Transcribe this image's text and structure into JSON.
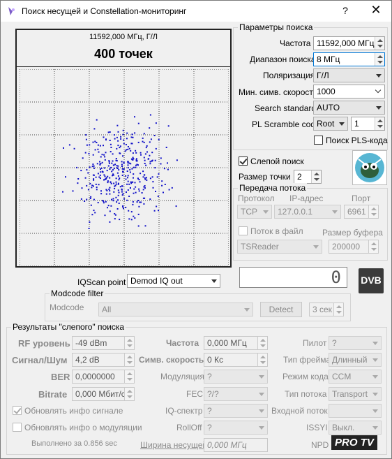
{
  "window": {
    "title": "Поиск несущей и Constellation-мониторинг",
    "help": "?",
    "close": "✕"
  },
  "constellation": {
    "freq_label": "11592,000 МГц, Г/Л",
    "points_label": "400 точек"
  },
  "search_params": {
    "group_title": "Параметры поиска",
    "freq_label": "Частота",
    "freq_value": "11592,000 МГц",
    "range_label": "Диапазон поиска",
    "range_value": "8 МГц",
    "pol_label": "Поляризация",
    "pol_value": "Г/Л",
    "symrate_label": "Мин. симв. скорость",
    "symrate_value": "1000",
    "standard_label": "Search standard",
    "standard_value": "AUTO",
    "pls_label": "PL Scramble code",
    "pls_mode": "Root",
    "pls_value": "1",
    "pls_search_label": "Поиск PLS-кода"
  },
  "blind": {
    "label": "Слепой поиск",
    "dot_size_label": "Размер точки",
    "dot_size_value": "2"
  },
  "stream": {
    "group_title": "Передача потока",
    "protocol_label": "Протокол",
    "ip_label": "IP-адрес",
    "port_label": "Порт",
    "protocol_value": "TCP",
    "ip_value": "127.0.0.1",
    "port_value": "6961",
    "to_file_label": "Поток в файл",
    "buffer_label": "Размер буфера",
    "app_value": "TSReader",
    "buffer_value": "200000"
  },
  "iqscan": {
    "label": "IQScan point",
    "value": "Demod IQ out",
    "counter": "0",
    "logo": "DVB"
  },
  "modcode": {
    "group_title": "Modcode filter",
    "label": "Modcode",
    "value": "All",
    "detect": "Detect",
    "timeout": "3 сек"
  },
  "results": {
    "group_title": "Результаты \"слепого\" поиска",
    "rf_label": "RF уровень",
    "rf_value": "-49 dBm",
    "snr_label": "Сигнал/Шум",
    "snr_value": "4,2 dB",
    "ber_label": "BER",
    "ber_value": "0,0000000",
    "bitrate_label": "Bitrate",
    "bitrate_value": "0,000 Мбит/с",
    "freq_label": "Частота",
    "freq_value": "0,000 МГц",
    "sym_label": "Симв. скорость",
    "sym_value": "0 Кс",
    "mod_label": "Модуляция",
    "mod_value": "?",
    "fec_label": "FEC",
    "fec_value": "?/?",
    "iq_label": "IQ-спектр",
    "iq_value": "?",
    "rolloff_label": "RollOff",
    "rolloff_value": "?",
    "pilot_label": "Пилот",
    "pilot_value": "?",
    "frame_label": "Тип фрейма",
    "frame_value": "Длинный",
    "codemode_label": "Режим кода",
    "codemode_value": "CCM",
    "streamtype_label": "Тип потока",
    "streamtype_value": "Transport",
    "input_label": "Входной поток",
    "input_value": "",
    "issyi_label": "ISSYI",
    "issyi_value": "Выкл.",
    "npd_label": "NPD",
    "update_signal_label": "Обновлять инфо сигнале",
    "update_mod_label": "Обновлять инфо о модуляции",
    "done_label": "Выполнено за 0.856 sec",
    "bandwidth_label": "Ширина несущей",
    "bandwidth_value": "0,000 МГц"
  },
  "watermark": "PRO TV"
}
